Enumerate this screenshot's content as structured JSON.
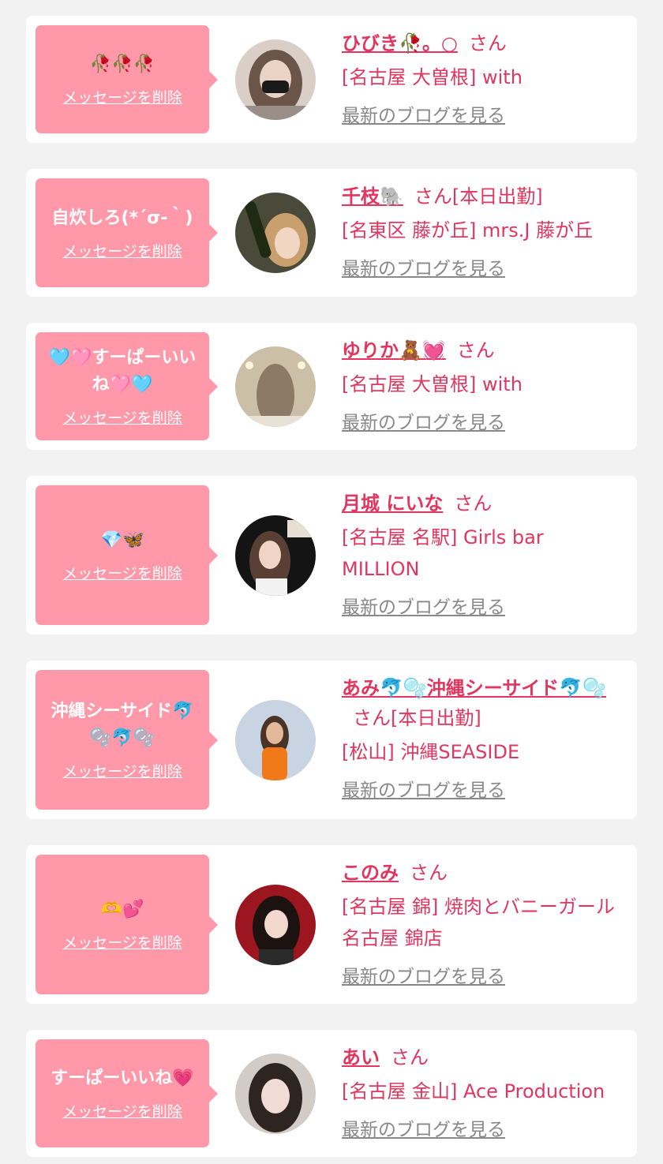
{
  "accent_color": "#e0365f",
  "bubble_color": "#ff98a8",
  "delete_label": "メッセージを削除",
  "blog_label": "最新のブログを見る",
  "cards": [
    {
      "message": "🥀🥀🥀",
      "name": "ひびき🥀。○",
      "honorific": "さん",
      "shop": "[名古屋 大曽根] with"
    },
    {
      "message": "自炊しろ(*´σ-｀)",
      "name": "千枝🐘",
      "honorific": "さん[本日出勤]",
      "shop": "[名東区 藤が丘] mrs.J 藤が丘"
    },
    {
      "message": "🩵🩷すーぱーいいね🩷🩵",
      "name": "ゆりか🧸💓",
      "honorific": "さん",
      "shop": "[名古屋 大曽根] with"
    },
    {
      "message": "💎🦋",
      "name": "月城 にいな",
      "honorific": "さん",
      "shop": "[名古屋 名駅] Girls bar MILLION"
    },
    {
      "message": "沖縄シーサイド🐬🫧🐬🫧",
      "name": "あみ🐬🫧沖縄シーサイド🐬🫧",
      "honorific": "さん[本日出勤]",
      "shop": "[松山] 沖縄SEASIDE"
    },
    {
      "message": "🫶💕",
      "name": "このみ",
      "honorific": "さん",
      "shop": "[名古屋 錦] 焼肉とバニーガール 名古屋 錦店"
    },
    {
      "message": "すーぱーいいね💗",
      "name": "あい",
      "honorific": "さん",
      "shop": "[名古屋 金山] Ace Production"
    }
  ]
}
